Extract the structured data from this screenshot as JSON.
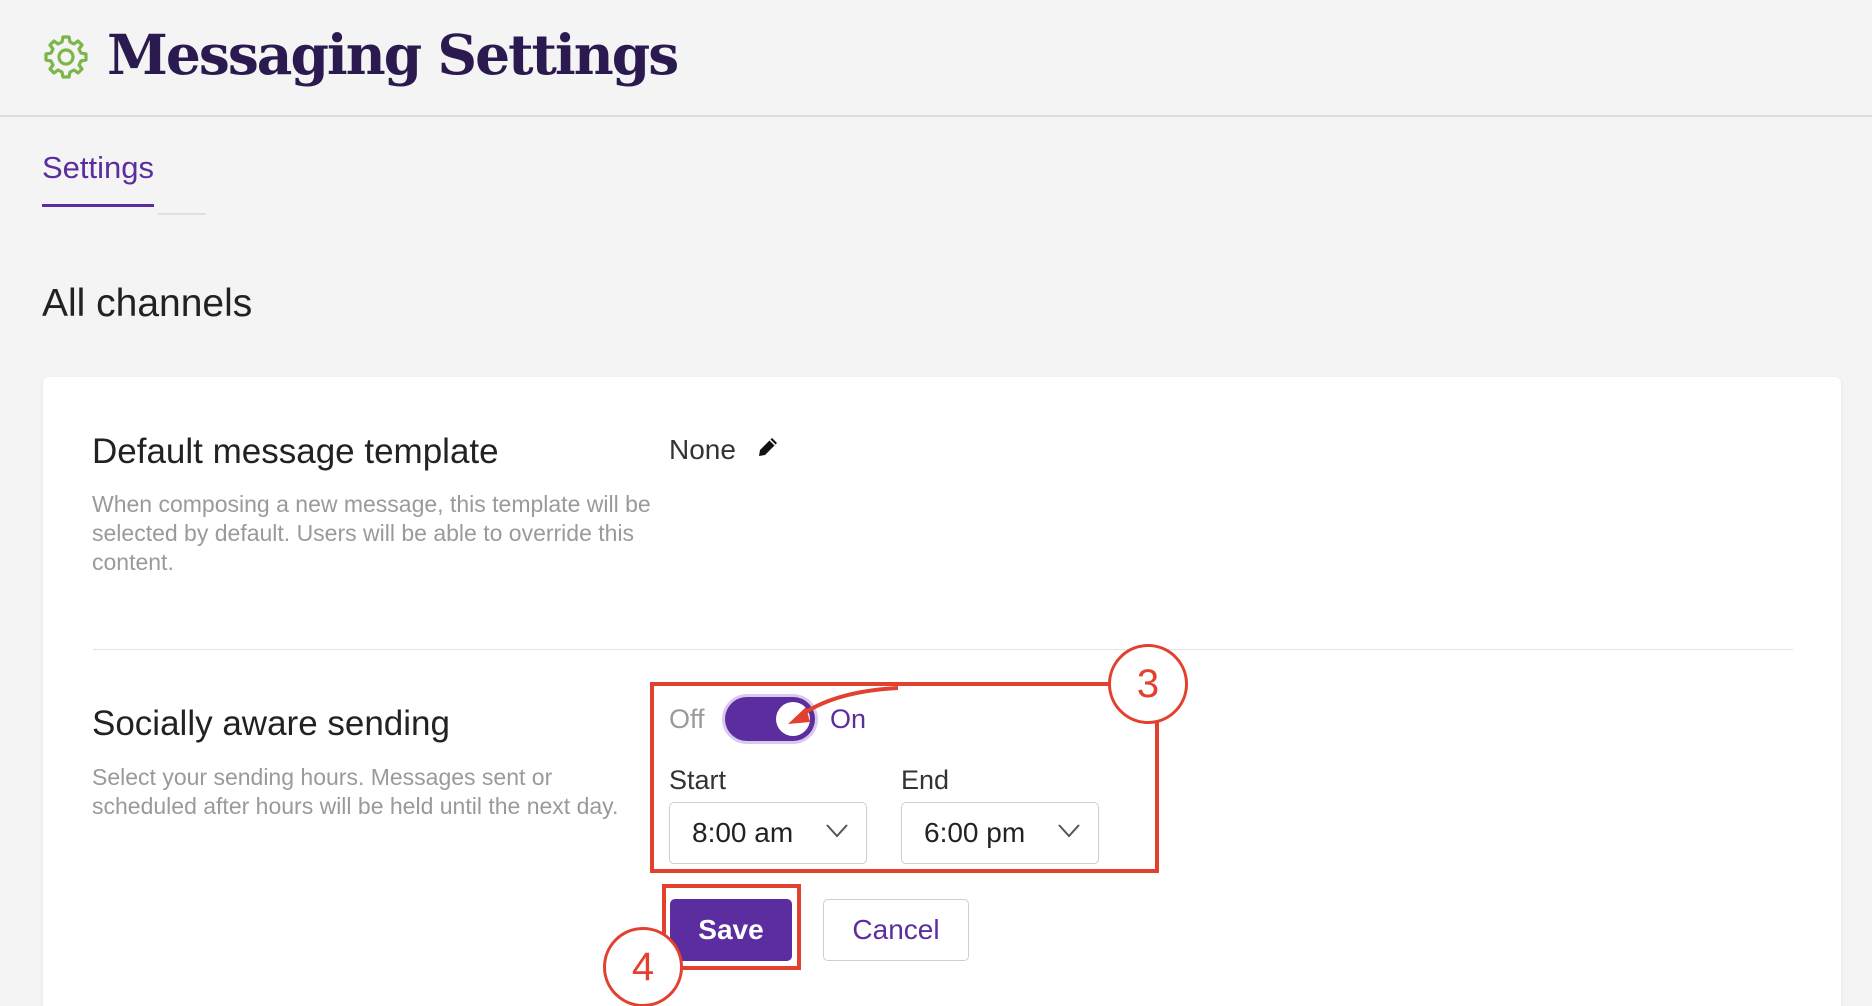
{
  "header": {
    "title": "Messaging Settings",
    "icon": "gear-icon",
    "icon_color": "#7ab648"
  },
  "tabs": [
    {
      "label": "Settings",
      "active": true
    }
  ],
  "section": {
    "title": "All channels"
  },
  "default_template": {
    "title": "Default message template",
    "description": "When composing a new message, this template will be selected by default. Users will be able to override this content.",
    "value": "None"
  },
  "socially_aware": {
    "title": "Socially aware sending",
    "description": "Select your sending hours. Messages sent or scheduled after hours will be held until the next day.",
    "toggle": {
      "off_label": "Off",
      "on_label": "On",
      "state": "on"
    },
    "start": {
      "label": "Start",
      "value": "8:00 am"
    },
    "end": {
      "label": "End",
      "value": "6:00 pm"
    }
  },
  "actions": {
    "save_label": "Save",
    "cancel_label": "Cancel"
  },
  "annotations": {
    "step_3": "3",
    "step_4": "4",
    "color": "#e2412f"
  },
  "colors": {
    "accent": "#5b2d9e",
    "title": "#2b1a4f",
    "gear": "#7ab648"
  }
}
